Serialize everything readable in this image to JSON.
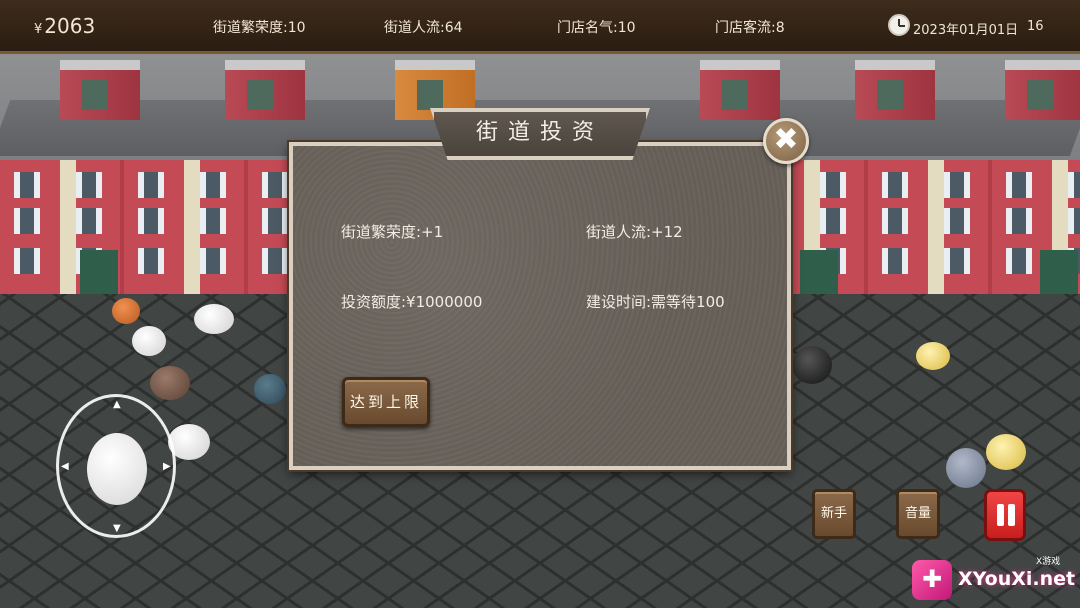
{
  "hud": {
    "currency_symbol": "¥",
    "money": "2063",
    "prosperity": "街道繁荣度:10",
    "traffic": "街道人流:64",
    "reputation": "门店名气:10",
    "customers": "门店客流:8",
    "date": "2023年01月01日",
    "time": "16",
    "icons": [
      "clock-icon"
    ]
  },
  "dialog": {
    "title": "街道投资",
    "close_glyph": "✖",
    "prosperity_bonus": "街道繁荣度:+1",
    "traffic_bonus": "街道人流:+12",
    "investment": "投资额度:¥1000000",
    "build_time": "建设时间:需等待100",
    "limit_button": "达到上限"
  },
  "controls": {
    "newbie_button": "新手",
    "volume_button": "音量",
    "arrows": [
      "▲",
      "▼",
      "◀",
      "▶"
    ]
  },
  "watermark": {
    "logo_glyph": "✚",
    "tag": "X游戏",
    "text": "XYouXi.net"
  },
  "colors": {
    "hud_bg": "#2a1d11",
    "dialog_bg": "#675f58",
    "button_brown": "#7a5a3a",
    "pause_red": "#e03030"
  }
}
